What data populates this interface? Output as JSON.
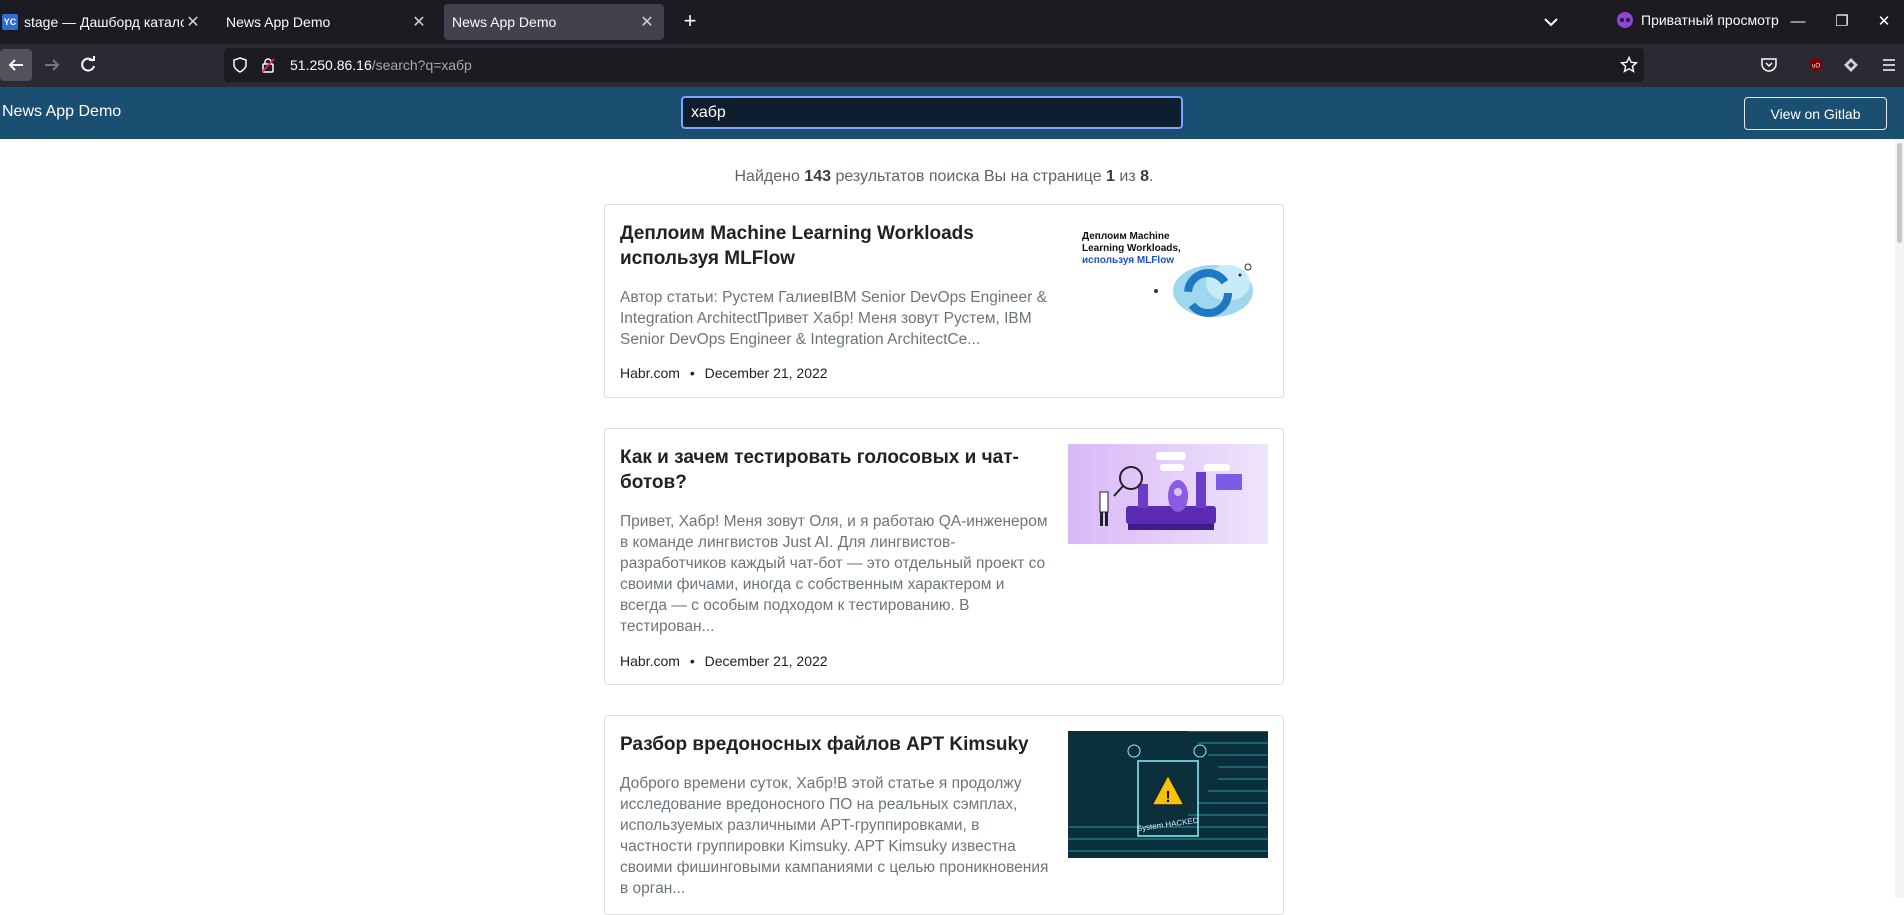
{
  "browser": {
    "tabs": [
      {
        "title": "stage — Дашборд каталога | Y",
        "favicon": "YC"
      },
      {
        "title": "News App Demo"
      },
      {
        "title": "News App Demo"
      }
    ],
    "private_label": "Приватный просмотр",
    "url_host": "51.250.86.16",
    "url_path": "/search?q=хабр"
  },
  "header": {
    "brand": "News App Demo",
    "search_value": "хабр",
    "gitlab_label": "View on Gitlab"
  },
  "summary": {
    "prefix": "Найдено",
    "count": "143",
    "middle": "результатов поиска Вы на странице",
    "page": "1",
    "of": "из",
    "pages": "8",
    "suffix": "."
  },
  "articles": [
    {
      "title": "Деплоим Machine Learning Workloads используя MLFlow",
      "description": "Автор статьи: Рустем ГалиевIBM Senior DevOps Engineer & Integration ArchitectПривет Хабр! Меня зовут Рустем, IBM Senior DevOps Engineer & Integration ArchitectCe...",
      "source": "Habr.com",
      "date": "December 21, 2022",
      "image_text_1": "Деплоим Machine",
      "image_text_2": "Learning Workloads,",
      "image_text_3": "используя MLFlow"
    },
    {
      "title": "Как и зачем тестировать голосовых и чат-ботов?",
      "description": "Привет, Хабр! Меня зовут Оля, и я работаю QA-инженером в команде лингвистов Just AI. Для лингвистов-разработчиков каждый чат-бот — это отдельный проект со своими фичами, иногда с собственным характером и всегда — с особым подходом к тестированию. В тестирован...",
      "source": "Habr.com",
      "date": "December 21, 2022"
    },
    {
      "title": "Разбор вредоносных файлов APT Kimsuky",
      "description": "Доброго времени суток, Хабр!В этой статье я продолжу исследование вредоносного ПО на реальных сэмплах, используемых различными APT-группировками, в частности группировки Kimsuky. APT Kimsuky известна своими фишинговыми кампаниями с целью проникновения в орган...",
      "image_text": "System HACKED"
    }
  ],
  "separator": "•"
}
